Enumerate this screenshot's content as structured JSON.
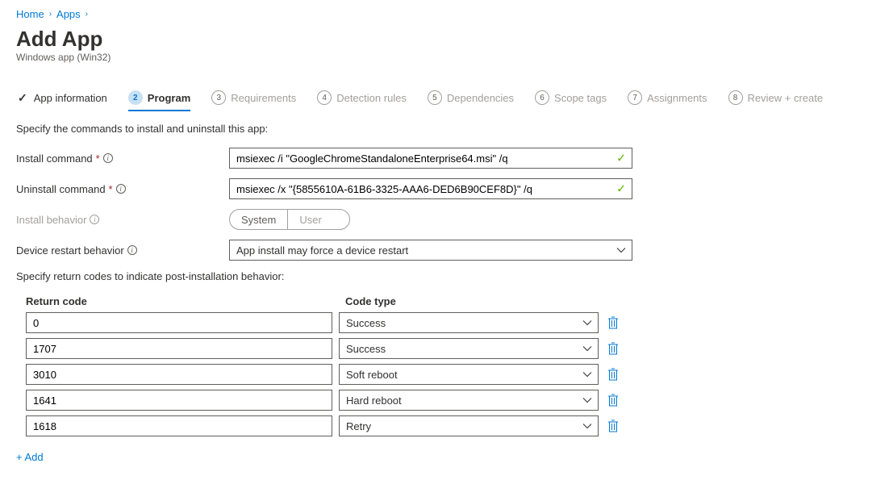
{
  "breadcrumb": {
    "home": "Home",
    "apps": "Apps"
  },
  "page": {
    "title": "Add App",
    "subtitle": "Windows app (Win32)"
  },
  "steps": [
    {
      "num": "",
      "label": "App information",
      "state": "complete"
    },
    {
      "num": "2",
      "label": "Program",
      "state": "active"
    },
    {
      "num": "3",
      "label": "Requirements",
      "state": "future"
    },
    {
      "num": "4",
      "label": "Detection rules",
      "state": "future"
    },
    {
      "num": "5",
      "label": "Dependencies",
      "state": "future"
    },
    {
      "num": "6",
      "label": "Scope tags",
      "state": "future"
    },
    {
      "num": "7",
      "label": "Assignments",
      "state": "future"
    },
    {
      "num": "8",
      "label": "Review + create",
      "state": "future"
    }
  ],
  "text": {
    "commands_desc": "Specify the commands to install and uninstall this app:",
    "returncodes_desc": "Specify return codes to indicate post-installation behavior:"
  },
  "form": {
    "install_label": "Install command",
    "install_value": "msiexec /i \"GoogleChromeStandaloneEnterprise64.msi\" /q",
    "uninstall_label": "Uninstall command",
    "uninstall_value": "msiexec /x \"{5855610A-61B6-3325-AAA6-DED6B90CEF8D}\" /q",
    "behavior_label": "Install behavior",
    "behavior_options": {
      "system": "System",
      "user": "User"
    },
    "restart_label": "Device restart behavior",
    "restart_value": "App install may force a device restart"
  },
  "table": {
    "col_code": "Return code",
    "col_type": "Code type",
    "rows": [
      {
        "code": "0",
        "type": "Success"
      },
      {
        "code": "1707",
        "type": "Success"
      },
      {
        "code": "3010",
        "type": "Soft reboot"
      },
      {
        "code": "1641",
        "type": "Hard reboot"
      },
      {
        "code": "1618",
        "type": "Retry"
      }
    ],
    "add_label": "+ Add"
  },
  "required_mark": "*"
}
